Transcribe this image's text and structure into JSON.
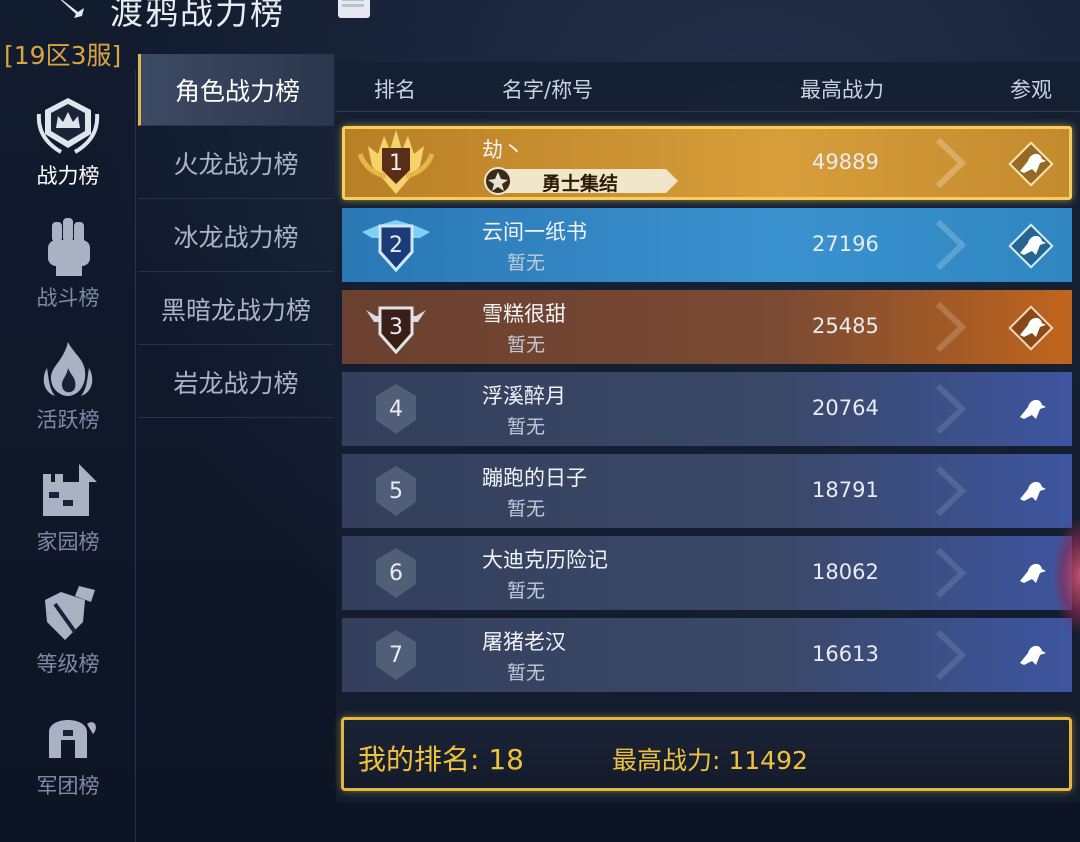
{
  "header": {
    "title": "渡鸦战力榜",
    "server": "[19区3服]"
  },
  "rail": [
    {
      "label": "战力榜",
      "icon": "crown-laurel-icon",
      "active": true
    },
    {
      "label": "战斗榜",
      "icon": "fist-icon",
      "active": false
    },
    {
      "label": "活跃榜",
      "icon": "flame-icon",
      "active": false
    },
    {
      "label": "家园榜",
      "icon": "castle-icon",
      "active": false
    },
    {
      "label": "等级榜",
      "icon": "shield-sword-icon",
      "active": false
    },
    {
      "label": "军团榜",
      "icon": "helmet-icon",
      "active": false
    }
  ],
  "subtabs": [
    {
      "label": "角色战力榜",
      "active": true
    },
    {
      "label": "火龙战力榜",
      "active": false
    },
    {
      "label": "冰龙战力榜",
      "active": false
    },
    {
      "label": "黑暗龙战力榜",
      "active": false
    },
    {
      "label": "岩龙战力榜",
      "active": false
    }
  ],
  "table": {
    "headers": {
      "rank": "排名",
      "name": "名字/称号",
      "power": "最高战力",
      "view": "参观"
    },
    "rows": [
      {
        "rank": "1",
        "name": "劫丶",
        "title": "勇士集结",
        "power": "49889",
        "tier": "gold"
      },
      {
        "rank": "2",
        "name": "云间一纸书",
        "title": "暂无",
        "power": "27196",
        "tier": "blue"
      },
      {
        "rank": "3",
        "name": "雪糕很甜",
        "title": "暂无",
        "power": "25485",
        "tier": "bronze"
      },
      {
        "rank": "4",
        "name": "浮溪醉月",
        "title": "暂无",
        "power": "20764",
        "tier": "normal"
      },
      {
        "rank": "5",
        "name": "蹦跑的日子",
        "title": "暂无",
        "power": "18791",
        "tier": "normal"
      },
      {
        "rank": "6",
        "name": "大迪克历险记",
        "title": "暂无",
        "power": "18062",
        "tier": "normal"
      },
      {
        "rank": "7",
        "name": "屠猪老汉",
        "title": "暂无",
        "power": "16613",
        "tier": "normal"
      }
    ]
  },
  "my_rank": {
    "rank_label": "我的排名: 18",
    "power_label": "最高战力: 11492"
  },
  "colors": {
    "gold": "#c98e2c",
    "blue": "#2f86c0",
    "bronze": "#7a4a33",
    "normal": "#3a4868",
    "accent": "#f0c23c"
  }
}
